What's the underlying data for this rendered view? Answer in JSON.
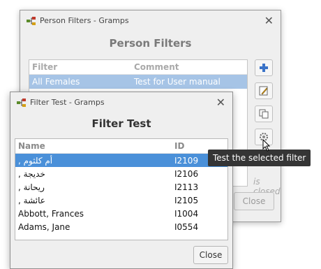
{
  "back_window": {
    "title": "Person Filters - Gramps",
    "heading": "Person Filters",
    "columns": [
      "Filter",
      "Comment"
    ],
    "rows": [
      {
        "filter": "All Females",
        "comment": "Test for User manual"
      }
    ],
    "side_buttons": [
      "add-icon",
      "edit-icon",
      "copy-icon",
      "test-icon"
    ],
    "status_text": "is closed",
    "close_label": "Close"
  },
  "front_window": {
    "title": "Filter Test - Gramps",
    "heading": "Filter Test",
    "columns": [
      "Name",
      "ID"
    ],
    "rows": [
      {
        "name": "أم كلثوم ,",
        "id": "I2109"
      },
      {
        "name": "خديجة ,",
        "id": "I2106"
      },
      {
        "name": "ريحانة ,",
        "id": "I2113"
      },
      {
        "name": "عائشة ,",
        "id": "I2105"
      },
      {
        "name": "Abbott, Frances",
        "id": "I1004"
      },
      {
        "name": "Adams, Jane",
        "id": "I0554"
      }
    ],
    "close_label": "Close"
  },
  "tooltip": "Test the selected filter"
}
